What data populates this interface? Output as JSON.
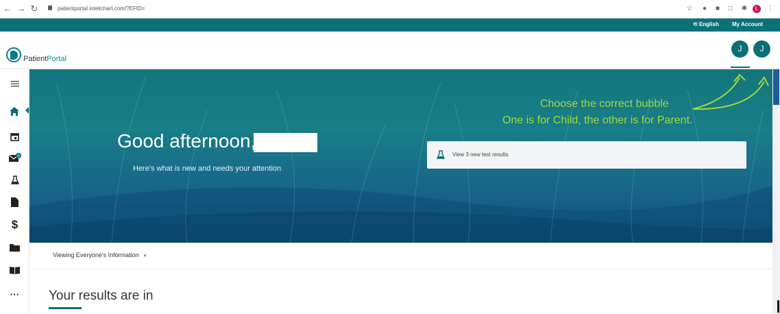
{
  "browser": {
    "url": "patientportal.intelichart.com/?EFID=",
    "profile_initial": "L"
  },
  "topbar": {
    "language": "English",
    "my_account": "My Account"
  },
  "header": {
    "logo_prefix": "Patient",
    "logo_suffix": "Portal",
    "bubbles": [
      "J",
      "J"
    ]
  },
  "sidebar": {
    "items": [
      {
        "icon": "hamburger-icon",
        "glyph": "≡"
      },
      {
        "icon": "home-icon",
        "glyph": "⌂",
        "active": true
      },
      {
        "icon": "calendar-icon",
        "glyph": "▣"
      },
      {
        "icon": "mail-icon",
        "glyph": "✉",
        "badge": "0"
      },
      {
        "icon": "flask-icon",
        "glyph": "⚗"
      },
      {
        "icon": "document-icon",
        "glyph": "▮"
      },
      {
        "icon": "dollar-icon",
        "glyph": "$"
      },
      {
        "icon": "folder-icon",
        "glyph": "▬"
      },
      {
        "icon": "book-icon",
        "glyph": "▥"
      },
      {
        "icon": "more-icon",
        "glyph": "···"
      }
    ]
  },
  "hero": {
    "greeting": "Good afternoon,",
    "subtitle": "Here's what is new and needs your attention",
    "test_card_label": "View 3 new test results"
  },
  "annotation": {
    "line1": "Choose the correct bubble",
    "line2": "One is for Child, the other is for Parent.",
    "color": "#a6d63f"
  },
  "content": {
    "viewing": "Viewing Everyone's Information",
    "results_heading": "Your results are in"
  },
  "colors": {
    "brand_teal": "#0b7278",
    "bubble": "#0a6f77"
  }
}
